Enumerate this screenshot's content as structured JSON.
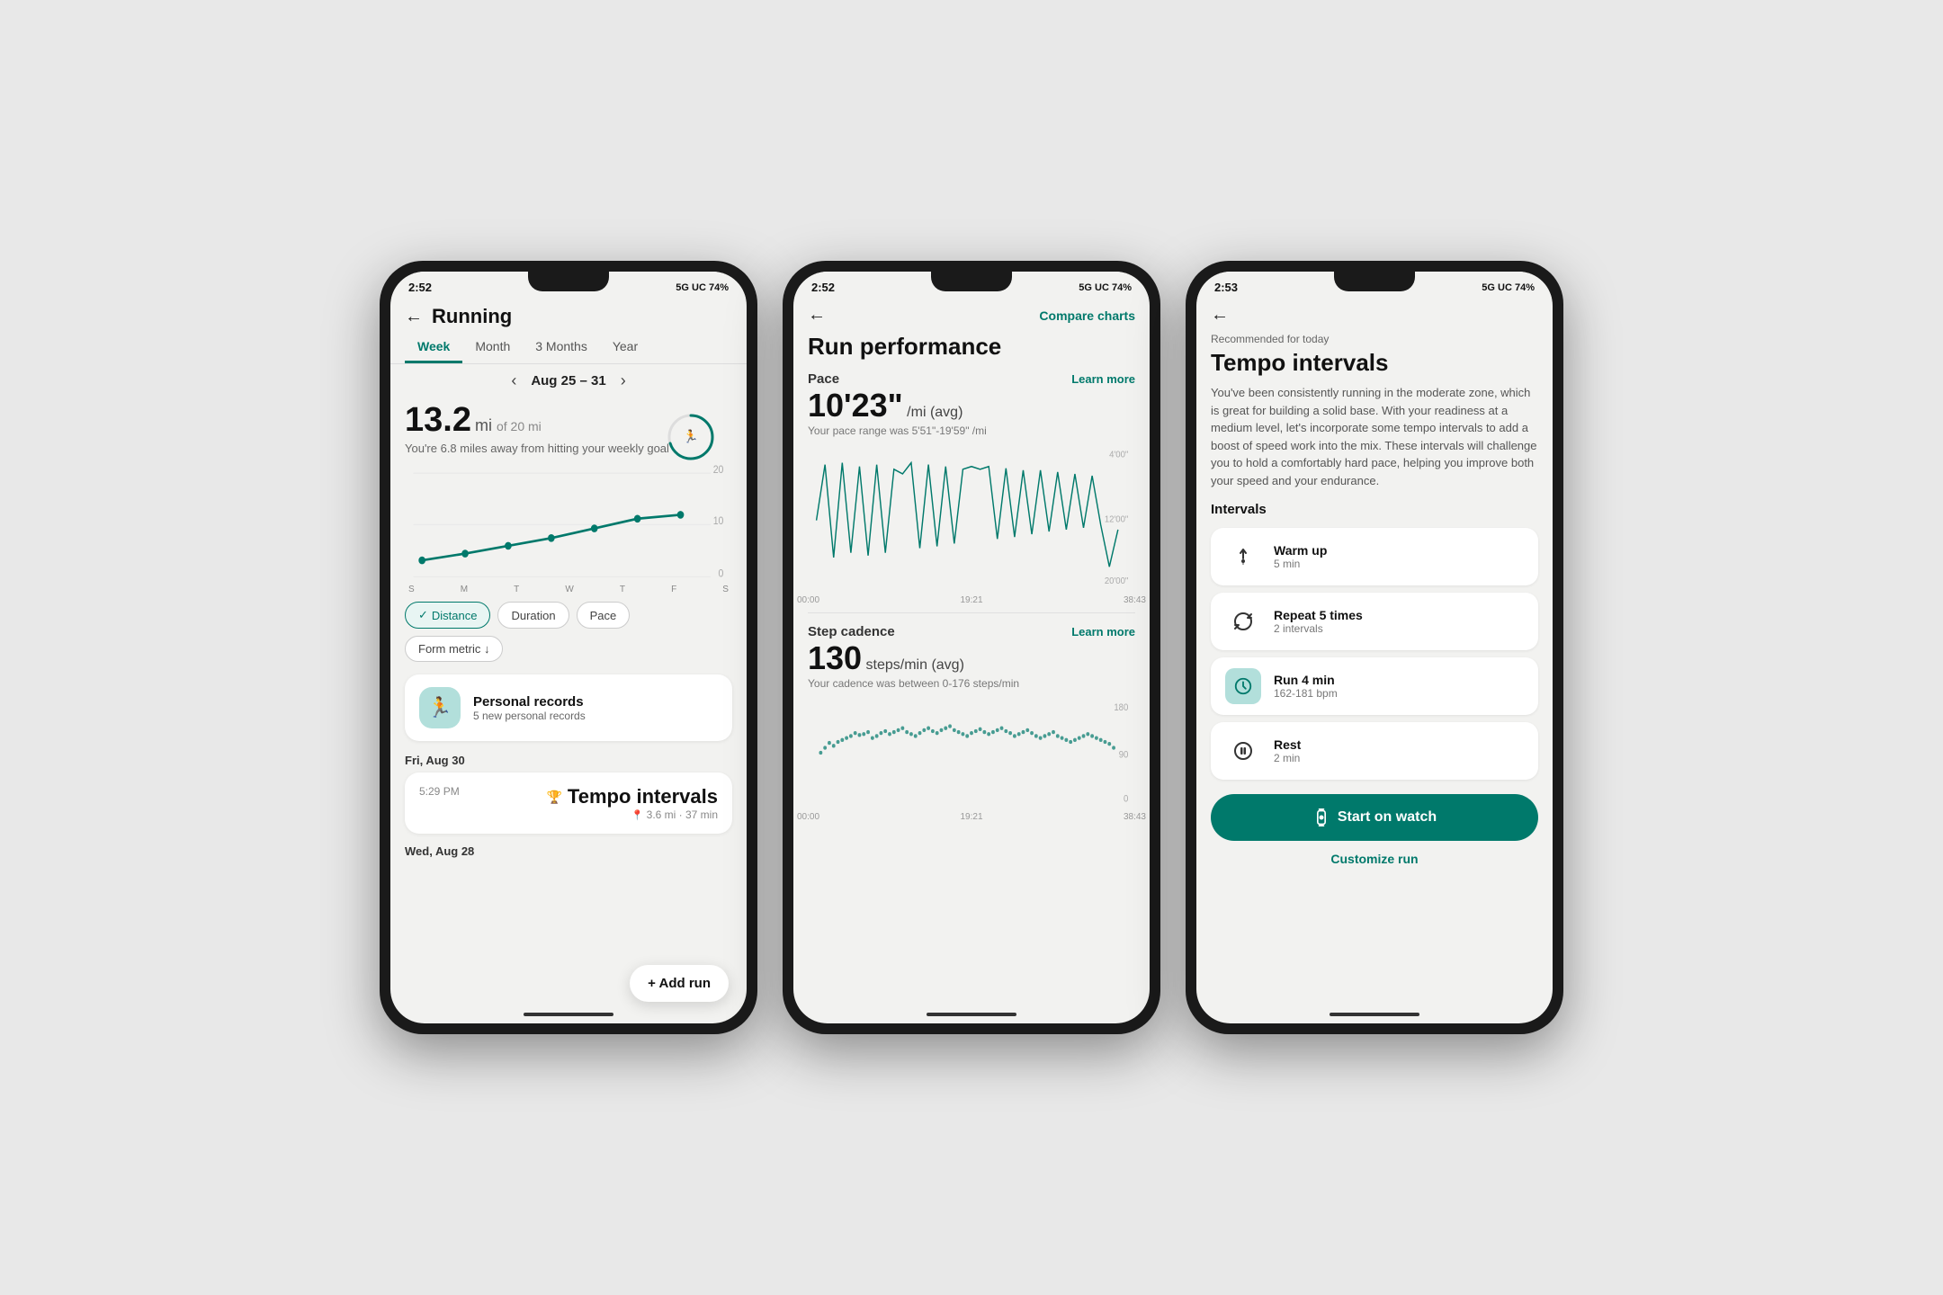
{
  "phone1": {
    "status_bar": {
      "time": "2:52",
      "icons": "5G UC 74%"
    },
    "title": "Running",
    "tabs": [
      "Week",
      "Month",
      "3 Months",
      "Year"
    ],
    "active_tab": "Week",
    "date_range": "Aug 25 – 31",
    "miles_current": "13.2",
    "miles_label": "mi",
    "miles_of": "of 20 mi",
    "miles_subtitle": "You're 6.8 miles away from hitting your weekly goal",
    "chart_y_labels": [
      "20",
      "10",
      "0"
    ],
    "day_labels": [
      "S",
      "M",
      "T",
      "W",
      "T",
      "F",
      "S"
    ],
    "filters": [
      "Distance",
      "Duration",
      "Pace",
      "Form metric ↓"
    ],
    "active_filter": "Distance",
    "personal_records": {
      "title": "Personal records",
      "subtitle": "5 new personal records"
    },
    "activity_date": "Fri, Aug 30",
    "activity_time": "5:29 PM",
    "activity_title": "Tempo intervals",
    "activity_stats": "3.6 mi · 37 min",
    "wed_label": "Wed, Aug 28",
    "add_run_label": "+ Add run"
  },
  "phone2": {
    "status_bar": {
      "time": "2:52",
      "icons": "5G UC 74%"
    },
    "compare_btn": "Compare charts",
    "title": "Run performance",
    "pace_label": "Pace",
    "learn_more": "Learn more",
    "pace_value": "10'23\"",
    "pace_unit": "/mi (avg)",
    "pace_range": "Your pace range was 5'51\"-19'59\" /mi",
    "chart_y_right": [
      "4'00\"",
      "12'00\"",
      "20'00\""
    ],
    "chart_x_labels": [
      "00:00",
      "19:21",
      "38:43"
    ],
    "cadence_label": "Step cadence",
    "cadence_learn_more": "Learn more",
    "cadence_value": "130",
    "cadence_unit": "steps/min (avg)",
    "cadence_range": "Your cadence was between 0-176 steps/min",
    "cadence_y_right": [
      "180",
      "90",
      "0"
    ],
    "cadence_x_labels": [
      "00:00",
      "19:21",
      "38:43"
    ]
  },
  "phone3": {
    "status_bar": {
      "time": "2:53",
      "icons": "5G UC 74%"
    },
    "recommended_label": "Recommended for today",
    "title": "Tempo intervals",
    "description": "You've been consistently running in the moderate zone, which is great for building a solid base. With your readiness at a medium level, let's incorporate some tempo intervals to add a boost of speed work into the mix. These intervals will challenge you to hold a comfortably hard pace, helping you improve both your speed and your endurance.",
    "intervals_label": "Intervals",
    "intervals": [
      {
        "icon": "↑",
        "title": "Warm up",
        "subtitle": "5 min",
        "teal_bg": false
      },
      {
        "icon": "↔",
        "title": "Repeat 5 times",
        "subtitle": "2 intervals",
        "teal_bg": false
      },
      {
        "icon": "⏱",
        "title": "Run 4 min",
        "subtitle": "162-181 bpm",
        "teal_bg": true
      },
      {
        "icon": "⏸",
        "title": "Rest",
        "subtitle": "2 min",
        "teal_bg": false
      }
    ],
    "start_watch_label": "Start on watch",
    "customize_run_label": "Customize run"
  }
}
